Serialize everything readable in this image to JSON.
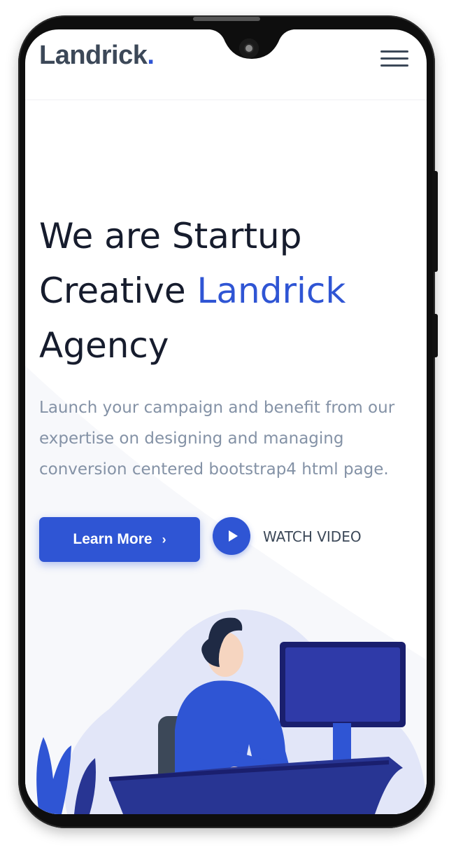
{
  "navbar": {
    "logo_text": "Landrick",
    "logo_dot": "."
  },
  "hero": {
    "headline_line1": "We are Startup",
    "headline_line2_plain": "Creative ",
    "headline_line2_accent": "Landrick",
    "headline_line3": "Agency",
    "subtext": "Launch your campaign and benefit from our expertise on designing and managing conversion centered bootstrap4 html page.",
    "learn_more_label": "Learn More",
    "learn_more_chevron": "›",
    "watch_video_label": "WATCH VIDEO"
  },
  "icons": {
    "menu": "hamburger-icon",
    "play": "play-icon",
    "chevron": "chevron-right-icon"
  },
  "colors": {
    "accent": "#2f55d4",
    "heading": "#161c2d",
    "muted": "#8492a6",
    "dark": "#3c4858"
  }
}
